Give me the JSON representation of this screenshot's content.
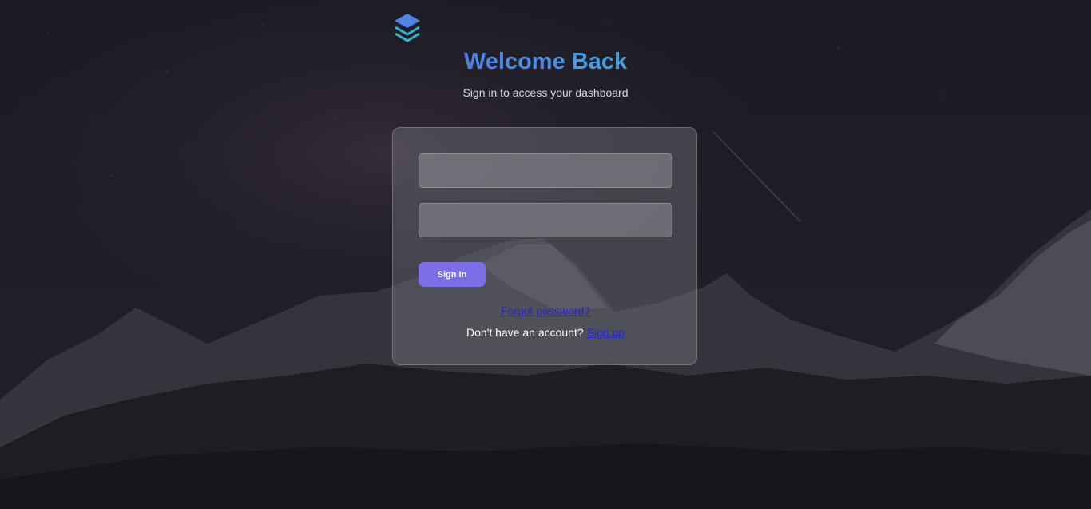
{
  "brand": {
    "logo_icon": "layers-stack-icon",
    "accent_start": "#4f7fe8",
    "accent_end": "#3fa3de"
  },
  "header": {
    "title": "Welcome Back",
    "subtitle": "Sign in to access your dashboard"
  },
  "form": {
    "username_value": "",
    "password_value": "",
    "submit_label": "Sign In",
    "submit_color": "#7c6ee6",
    "forgot_link": "Forgot password?",
    "signup_prompt": "Don't have an account? ",
    "signup_link": "Sign up"
  }
}
